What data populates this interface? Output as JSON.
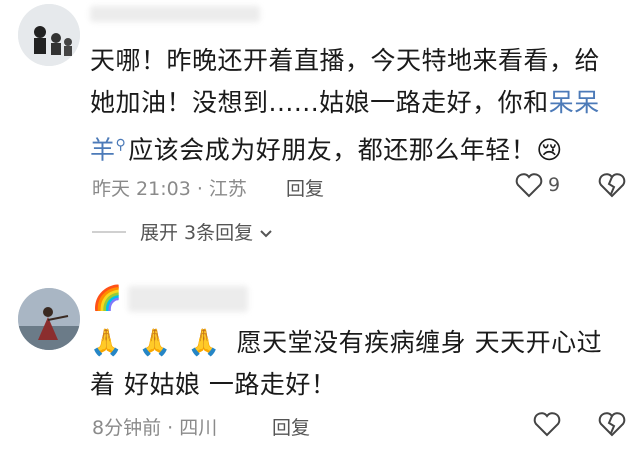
{
  "comments": [
    {
      "text_part1": "天哪！昨晚还开着直播，今天特地来看看，给她加油！没想到......姑娘一路走好，你和",
      "link_text": "呆呆羊",
      "link_icon": "search-icon",
      "text_part2": "应该会成为好朋友，都还那么年轻！😢",
      "meta": "昨天 21:03 · 江苏",
      "reply_label": "回复",
      "like_count": "9",
      "expand_label": "展开 3条回复"
    },
    {
      "name_emoji": "🌈",
      "hands": [
        "🙏",
        "🙏",
        "🙏"
      ],
      "text": "愿天堂没有疾病缠身 天天开心过着 好姑娘 一路走好！",
      "meta": "8分钟前 · 四川",
      "reply_label": "回复"
    }
  ],
  "colors": {
    "link": "#4c7ab8",
    "meta": "#8a8a8a",
    "background": "#ffffff"
  },
  "icons": [
    "heart-outline-icon",
    "broken-heart-icon",
    "chevron-down-icon"
  ]
}
